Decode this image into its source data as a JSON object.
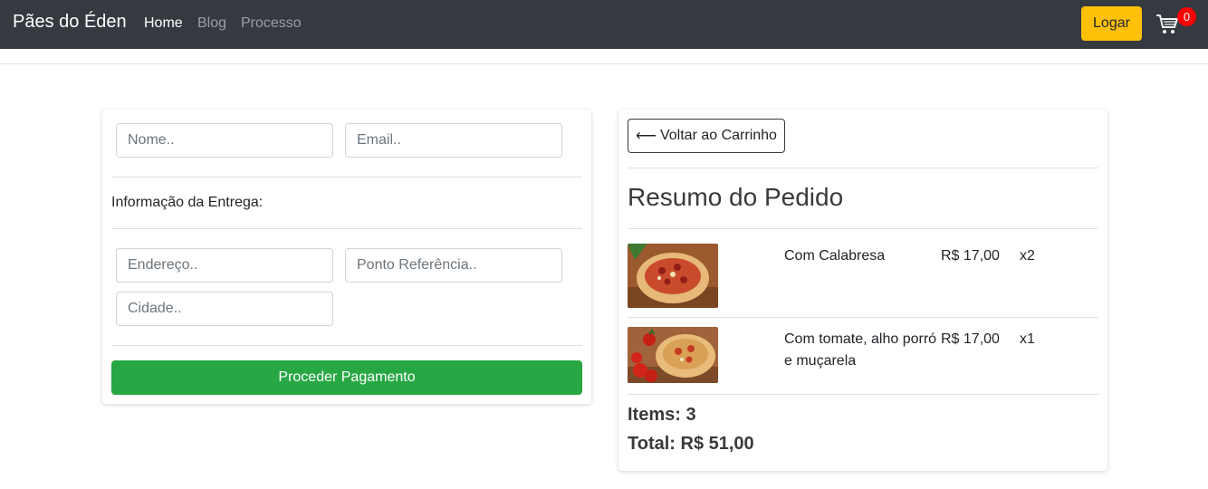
{
  "navbar": {
    "brand": "Pães do Éden",
    "links": [
      {
        "label": "Home",
        "active": true
      },
      {
        "label": "Blog",
        "active": false
      },
      {
        "label": "Processo",
        "active": false
      }
    ],
    "login_label": "Logar",
    "cart_count": "0",
    "cart_icon": "shopping-cart-icon",
    "colors": {
      "background": "#343a40",
      "login": "#ffc107",
      "badge": "#ff0000"
    }
  },
  "checkout_form": {
    "name_placeholder": "Nome..",
    "email_placeholder": "Email..",
    "delivery_label": "Informação da Entrega:",
    "address_placeholder": "Endereço..",
    "reference_placeholder": "Ponto Referência..",
    "city_placeholder": "Cidade..",
    "pay_label": "Proceder Pagamento",
    "pay_color": "#28a745"
  },
  "summary": {
    "back_arrow": "⟵",
    "back_label": "Voltar ao Carrinho",
    "title": "Resumo do Pedido",
    "items": [
      {
        "name": "Com Calabresa",
        "price": "R$ 17,00",
        "qty": "x2",
        "image": "calabresa-bread-photo"
      },
      {
        "name": "Com tomate, alho porró e muçarela",
        "price": "R$ 17,00",
        "qty": "x1",
        "image": "tomato-bread-photo"
      }
    ],
    "items_total": "Items: 3",
    "order_total": "Total: R$ 51,00"
  }
}
